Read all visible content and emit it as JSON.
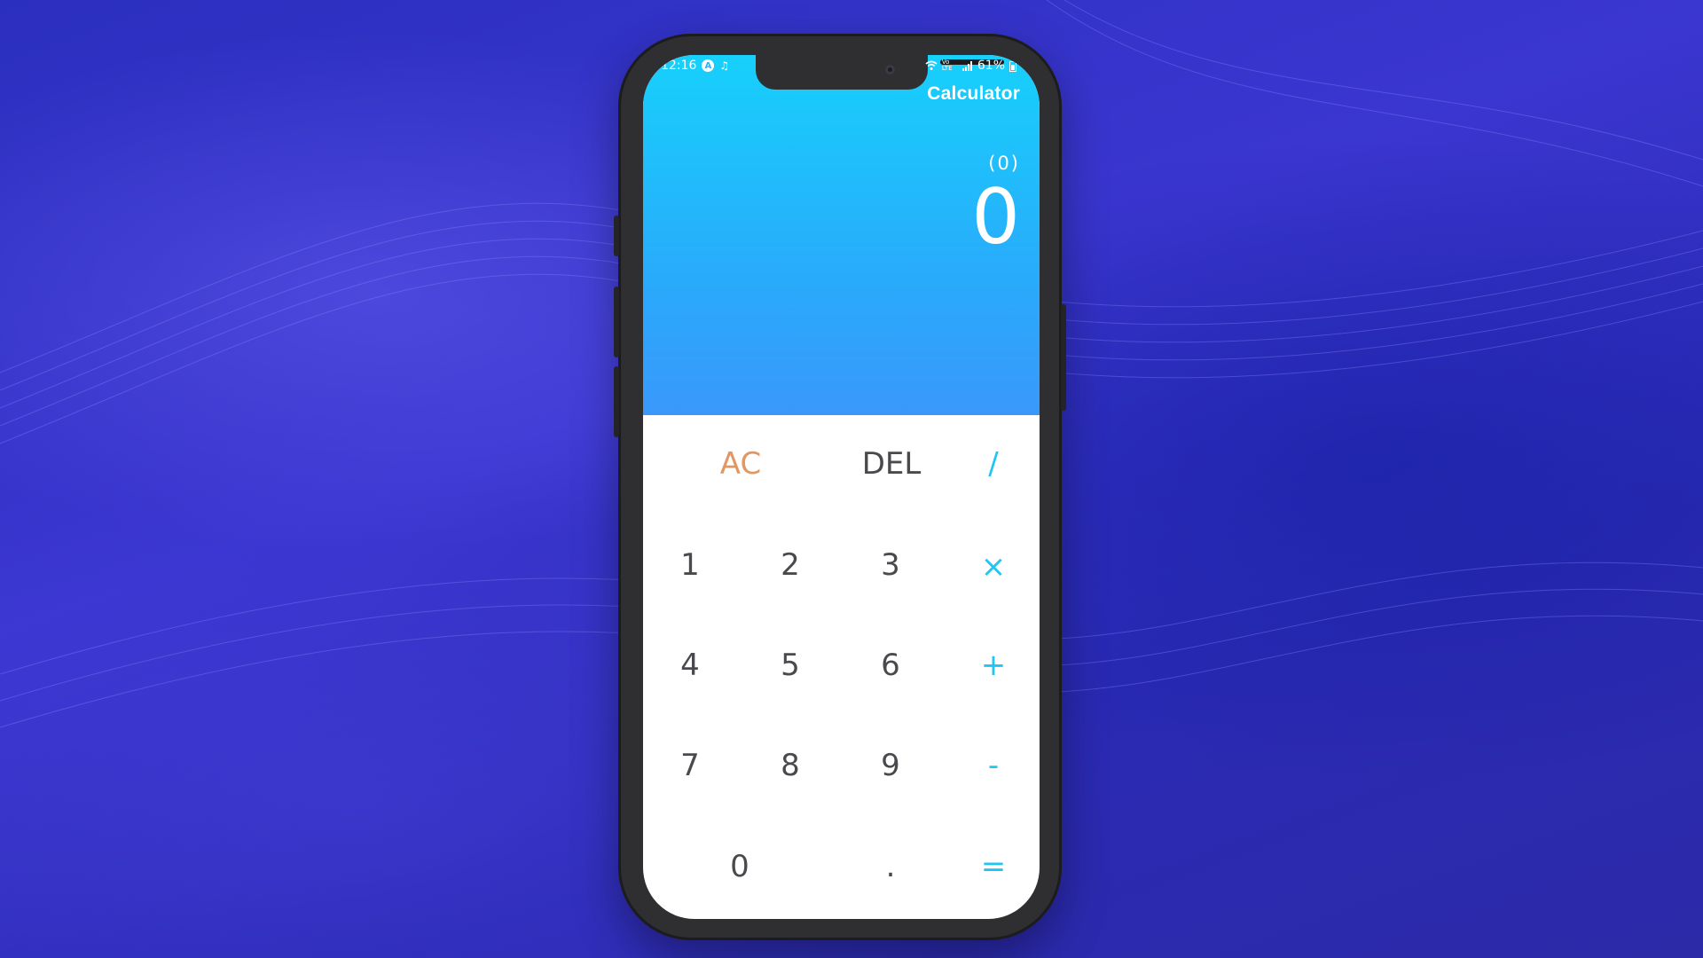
{
  "status_bar": {
    "time": "12:16",
    "app_badge": "A",
    "extra_icon": "♫",
    "signal_text": "Vo LTE",
    "battery": "61%"
  },
  "app": {
    "title": "Calculator"
  },
  "display": {
    "expression": "(0)",
    "result": "0"
  },
  "keypad": {
    "row1": [
      "AC",
      "DEL",
      "/"
    ],
    "row2": [
      "1",
      "2",
      "3",
      "×"
    ],
    "row3": [
      "4",
      "5",
      "6",
      "+"
    ],
    "row4": [
      "7",
      "8",
      "9",
      "-"
    ],
    "row5": [
      "0",
      ".",
      "="
    ]
  },
  "colors": {
    "display_top": "#17d0fb",
    "display_bottom": "#3a98fb",
    "operator": "#1fc6f4",
    "clear": "#e29660",
    "digit": "#4a4a4e",
    "background": "#2b2fbf"
  },
  "icons": [
    "wifi-icon",
    "signal-icon",
    "battery-icon",
    "camera-icon"
  ]
}
